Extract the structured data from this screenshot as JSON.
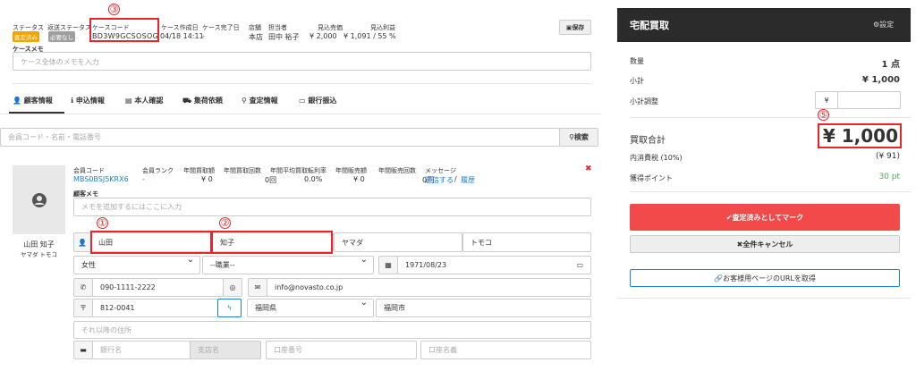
{
  "header": {
    "status_label": "ステータス",
    "return_status_label": "返送ステータス",
    "status_badge": "査定済み",
    "return_badge": "必要なし",
    "case_code_label": "ケースコード",
    "case_code": "BD3W9GCSOSOG",
    "created_label": "ケース作成日",
    "created": "04/18 14:11",
    "done_label": "ケース完了日",
    "done": "-",
    "store_label": "店舗",
    "store": "本店",
    "staff_label": "担当者",
    "staff": "田中 裕子",
    "est_sales_label": "見込売価",
    "est_sales": "¥ 2,000",
    "est_profit_label": "見込利益",
    "est_profit": "¥ 1,091 / 55 %",
    "save_label": "保存",
    "memo_label": "ケースメモ",
    "memo_placeholder": "ケース全体のメモを入力"
  },
  "tabs": [
    "顧客情報",
    "申込情報",
    "本人確認",
    "集荷依頼",
    "査定情報",
    "銀行振込"
  ],
  "search": {
    "placeholder": "会員コード・名前・電話番号",
    "button": "検索"
  },
  "customer": {
    "name": "山田 知子",
    "kana": "ヤマダ トモコ",
    "member_code_label": "会員コード",
    "member_code": "MBS0BSJ5KRX6",
    "rank_label": "会員ランク",
    "rank": "-",
    "buy_amount_label": "年間買取額",
    "buy_amount": "¥ 0",
    "buy_count_label": "年間買取回数",
    "buy_count": "0回",
    "avg_rate_label": "年間平均買取転利率",
    "avg_rate": "0.0%",
    "sale_amount_label": "年間販売額",
    "sale_amount": "¥ 0",
    "sale_count_label": "年間販売回数",
    "sale_count": "0回",
    "message_label": "メッセージ",
    "send_link": "送信する",
    "sep": "/",
    "history_link": "履歴",
    "memo_label": "顧客メモ",
    "memo_placeholder": "メモを追加するにはここに入力"
  },
  "form": {
    "last_name": "山田",
    "first_name": "知子",
    "last_kana": "ヤマダ",
    "first_kana": "トモコ",
    "gender": "女性",
    "job": "--職業--",
    "birthday": "1971/08/23",
    "phone": "090-1111-2222",
    "email": "info@novasto.co.jp",
    "zip": "812-0041",
    "pref": "福岡県",
    "city": "福岡市",
    "address_placeholder": "それ以降の住所",
    "bank_placeholder": "銀行名",
    "branch_placeholder": "支店名",
    "account_no_placeholder": "口座番号",
    "account_name_placeholder": "口座名義"
  },
  "annotations": [
    "①",
    "②",
    "③",
    "⑤"
  ],
  "panel": {
    "title": "宅配買取",
    "settings": "設定",
    "qty_label": "数量",
    "qty": "1 点",
    "subtotal_label": "小計",
    "subtotal": "¥ 1,000",
    "adjust_label": "小計調整",
    "yen": "¥",
    "total_label": "買取合計",
    "total": "¥ 1,000",
    "tax_label": "内消費税 (10%)",
    "tax": "(¥ 91)",
    "points_label": "獲得ポイント",
    "points": "30 pt",
    "assessed_button": "査定済みとしてマーク",
    "cancel_button": "全件キャンセル",
    "url_button": "お客様用ページのURLを取得"
  },
  "colors": {
    "accent": "#e8262a",
    "link": "#1a7fd6",
    "primary_btn": "#f2494a",
    "badge_yellow": "#f0a500",
    "badge_gray": "#9e9e9e",
    "dark": "#2b2b2b",
    "points": "#4caf50"
  }
}
